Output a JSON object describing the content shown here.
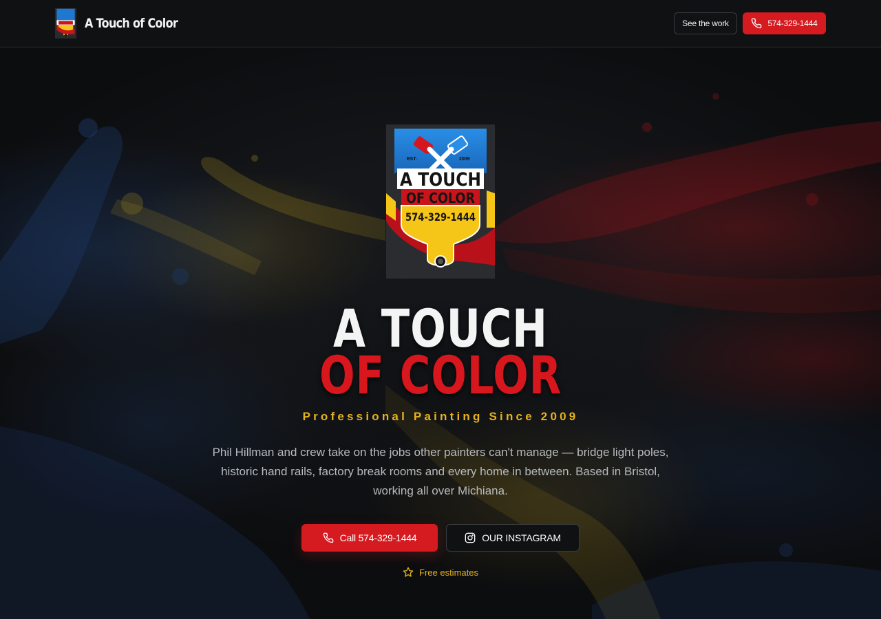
{
  "header": {
    "brand_name": "A Touch of Color",
    "see_work_label": "See the work",
    "phone_label": "574-329-1444"
  },
  "hero": {
    "logo": {
      "est_label": "EST.",
      "year": "2009",
      "line1": "A TOUCH",
      "line2": "OF COLOR",
      "phone": "574-329-1444"
    },
    "title_line1": "A TOUCH",
    "title_line2": "OF COLOR",
    "tagline": "Professional Painting Since 2009",
    "description": "Phil Hillman and crew take on the jobs other painters can't manage — bridge light poles, historic hand rails, factory break rooms and every home in between. Based in Bristol, working all over Michiana.",
    "call_button": "Call 574-329-1444",
    "instagram_button": "OUR INSTAGRAM",
    "free_estimates": "Free estimates"
  },
  "icons": {
    "phone": "phone-icon",
    "instagram": "instagram-icon",
    "star": "star-icon"
  },
  "colors": {
    "accent_red": "#d51a20",
    "accent_yellow": "#e7b21e",
    "accent_blue": "#1f6fc4",
    "background": "#0d0e10"
  }
}
